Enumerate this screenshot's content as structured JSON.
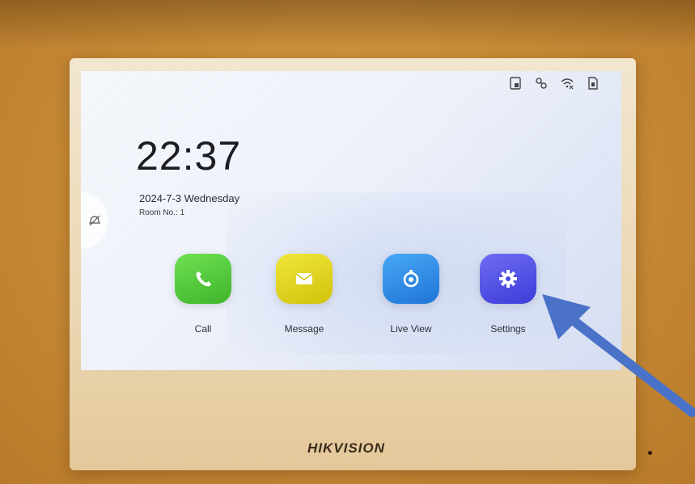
{
  "screen": {
    "time": "22:37",
    "date": "2024-7-3  Wednesday",
    "room": "Room No.: 1"
  },
  "status_icons": [
    "sd-card-icon",
    "link-icon",
    "wifi-off-icon",
    "sim-icon"
  ],
  "apps": [
    {
      "label": "Call",
      "color": "#4fc93a",
      "icon": "phone-icon"
    },
    {
      "label": "Message",
      "color": "#e2d51c",
      "icon": "mail-icon"
    },
    {
      "label": "Live View",
      "color": "#2e8de8",
      "icon": "camera-icon"
    },
    {
      "label": "Settings",
      "color": "#5a58e6",
      "icon": "gear-icon"
    }
  ],
  "device": {
    "brand": "HIKVISION"
  },
  "annotation": {
    "arrow_color": "#4a72c8",
    "target": "Settings"
  }
}
